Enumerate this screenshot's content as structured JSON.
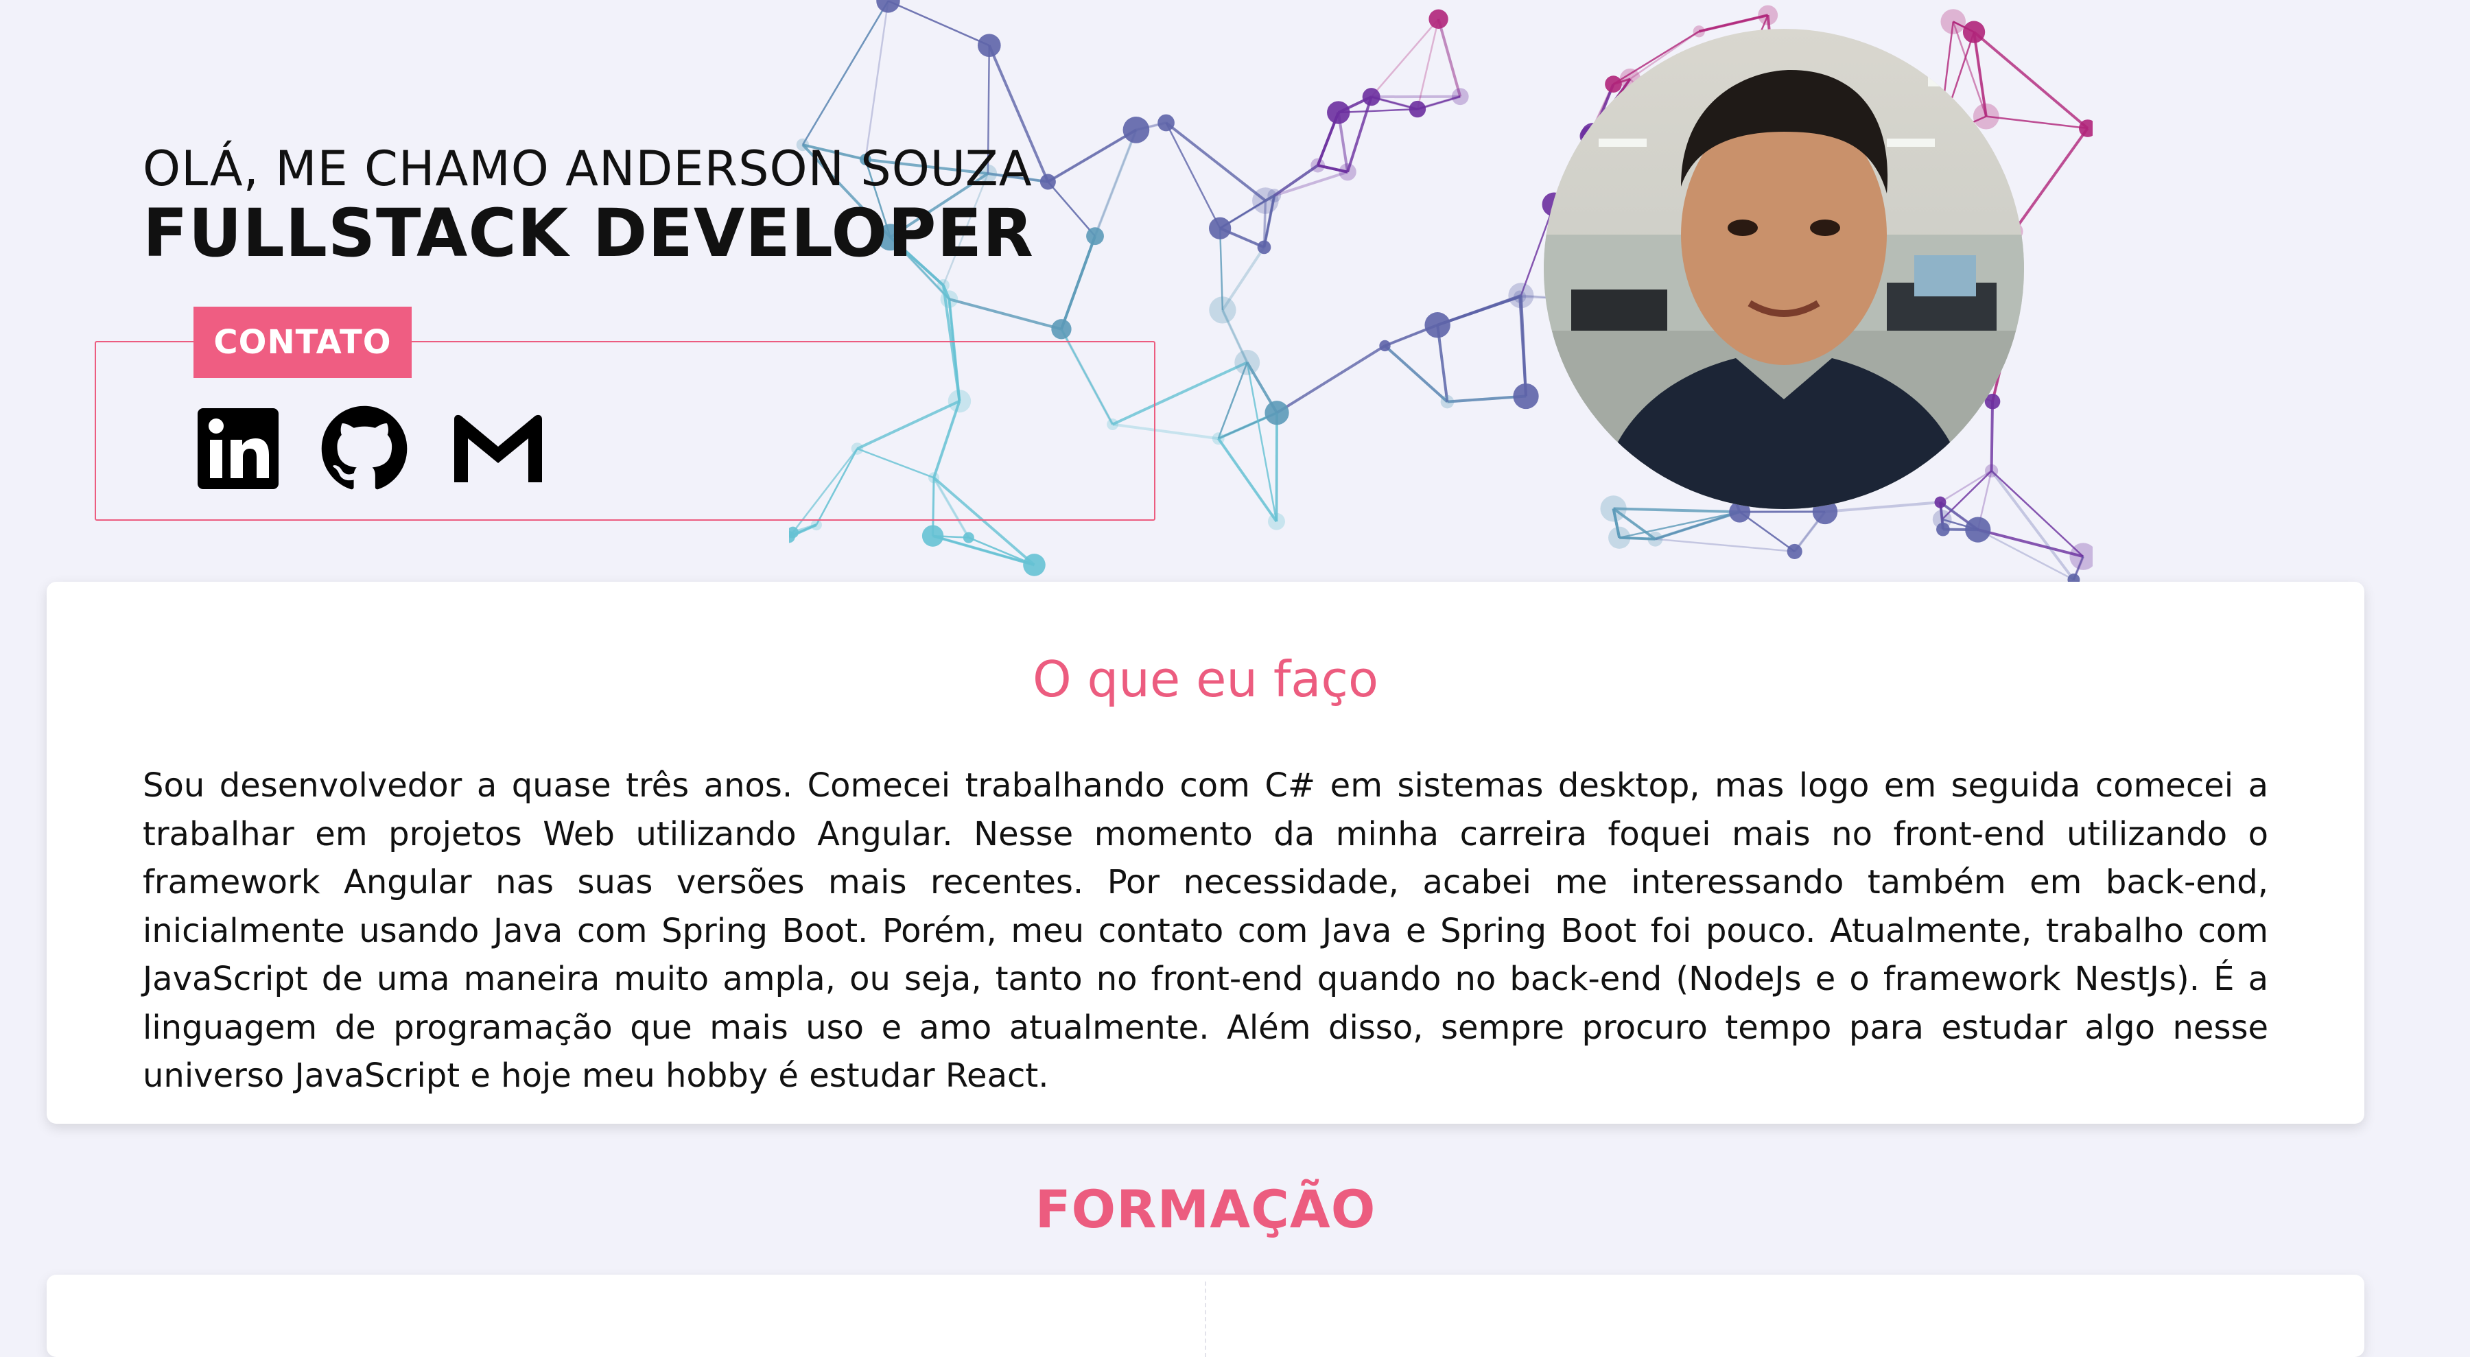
{
  "hero": {
    "greeting": "OLÁ, ME CHAMO ANDERSON SOUZA",
    "role": "FULLSTACK DEVELOPER"
  },
  "contact": {
    "label": "CONTATO",
    "links": [
      {
        "name": "LinkedIn",
        "icon": "linkedin-icon"
      },
      {
        "name": "GitHub",
        "icon": "github-icon"
      },
      {
        "name": "Gmail",
        "icon": "gmail-icon"
      }
    ]
  },
  "about": {
    "title": "O que eu faço",
    "text": "Sou desenvolvedor a quase três anos. Comecei trabalhando com C# em sistemas desktop, mas logo em seguida comecei a trabalhar em projetos Web utilizando Angular. Nesse momento da minha carreira foquei mais no front-end utilizando o framework Angular nas suas versões mais recentes. Por necessidade, acabei me interessando também em back-end, inicialmente usando Java com Spring Boot. Porém, meu contato com Java e Spring Boot foi pouco. Atualmente, trabalho com JavaScript de uma maneira muito ampla, ou seja, tanto no front-end quando no back-end (NodeJs e o framework NestJs). É a linguagem de programação que mais uso e amo atualmente. Além disso, sempre procuro tempo para estudar algo nesse universo JavaScript e hoje meu hobby é estudar React."
  },
  "education": {
    "title": "FORMAÇÃO"
  },
  "colors": {
    "accent": "#ec5c7f",
    "background": "#f2f2fa",
    "card": "#ffffff",
    "text": "#111111"
  }
}
